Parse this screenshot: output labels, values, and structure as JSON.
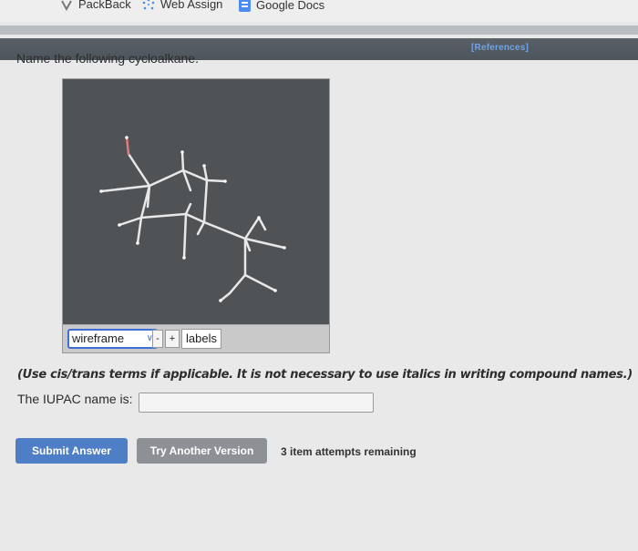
{
  "bookmarks": [
    {
      "label": "PackBack",
      "icon": "packback-icon"
    },
    {
      "label": "Web Assign",
      "icon": "webassign-icon"
    },
    {
      "label": "Google Docs",
      "icon": "google-docs-icon"
    }
  ],
  "header": {
    "references_label": "[References]"
  },
  "question": {
    "prompt": "Name the following cycloalkane.",
    "hint": "(Use cis/trans terms if applicable. It is not necessary to use italics in writing compound names.)",
    "iupac_label": "The IUPAC name is:",
    "iupac_value": ""
  },
  "viewer": {
    "render_mode": "wireframe",
    "minus_label": "-",
    "plus_label": "+",
    "labels_button": "labels"
  },
  "actions": {
    "submit_label": "Submit Answer",
    "try_label": "Try Another Version",
    "attempts_text": "3 item attempts remaining"
  },
  "colors": {
    "submit": "#4d7ec6",
    "try_another": "#8d9195",
    "viewer_bg": "#4f5356",
    "references": "#6ea4e4"
  }
}
